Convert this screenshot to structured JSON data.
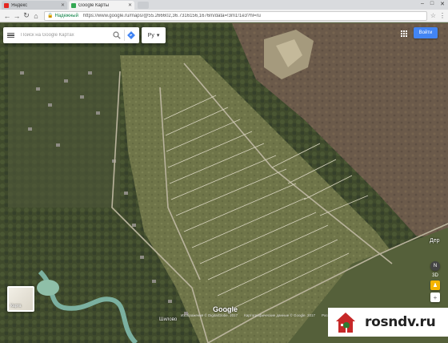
{
  "browser": {
    "tabs": [
      {
        "title": "Яндекс",
        "favicon_color": "#e52620",
        "active": false
      },
      {
        "title": "Google Карты",
        "favicon_color": "#34a853",
        "active": true
      }
    ],
    "secure_label": "Надежный",
    "url": "https://www.google.ru/maps/@55.266602,36.7316156,1676m/data=!3m1!1e3?hl=ru"
  },
  "map": {
    "search": {
      "placeholder": "Поиск на Google Картах"
    },
    "language_button": "Ру",
    "signin_label": "Войти",
    "thumbnail_label": "Карта",
    "place_label": "Дер",
    "village_label": "Шилово",
    "google_logo": "Google",
    "attribution": [
      "Изображения © DigitalGlobe, 2017",
      "Картографические данные © Google, 2017",
      "Россия",
      "Условия использования",
      "Отправить отзыв",
      "200 м"
    ],
    "zoom_label": "3D"
  },
  "watermark": {
    "text": "rosndv.ru"
  }
}
